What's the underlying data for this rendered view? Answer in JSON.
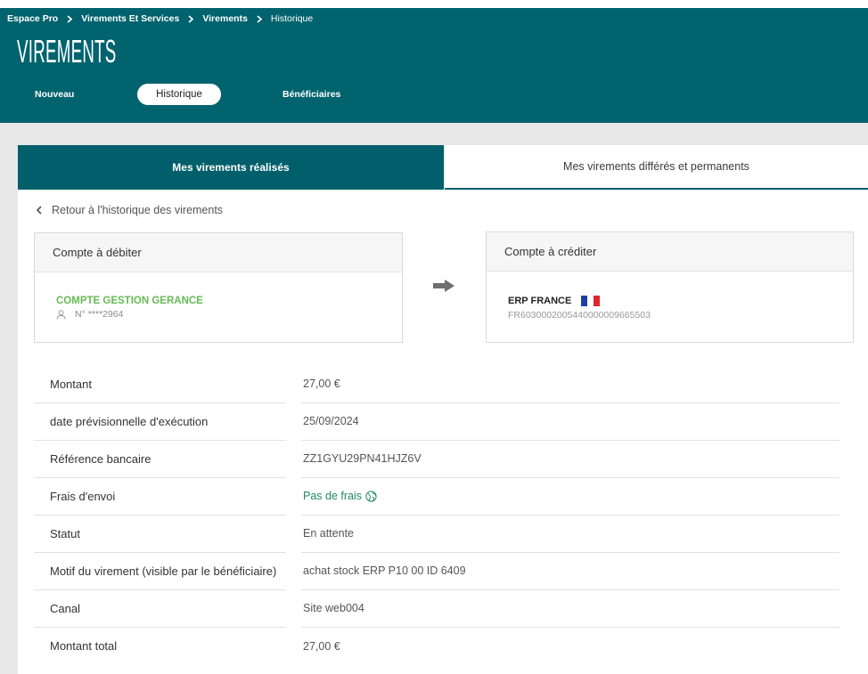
{
  "colors": {
    "header_bg": "#00636e",
    "tab_active_bg": "#005f6a",
    "page_bg": "#e8e8e8",
    "account_green": "#66bb55",
    "fee_green": "#1e8c5c"
  },
  "breadcrumb": {
    "items": [
      {
        "label": "Espace Pro"
      },
      {
        "label": "Virements Et Services"
      },
      {
        "label": "Virements"
      },
      {
        "label": "Historique"
      }
    ],
    "separator_icon": "chevron-right-icon"
  },
  "header": {
    "title": "VIREMENTS"
  },
  "nav": {
    "items": [
      {
        "label": "Nouveau",
        "active": false
      },
      {
        "label": "Historique",
        "active": true
      },
      {
        "label": "Bénéficiaires",
        "active": false
      }
    ]
  },
  "tabs": [
    {
      "label": "Mes virements réalisés",
      "active": true
    },
    {
      "label": "Mes virements différés et permanents",
      "active": false
    }
  ],
  "back_link": {
    "label": "Retour à l'historique des virements",
    "icon": "chevron-left-icon"
  },
  "debit_account": {
    "header": "Compte à débiter",
    "name": "COMPTE GESTION GERANCE",
    "number": "N° ****2964",
    "icon": "person-icon"
  },
  "transfer_icon": "arrow-right-icon",
  "credit_account": {
    "header": "Compte à créditer",
    "name": "ERP FRANCE",
    "iban": "FR6030002005440000009665503",
    "flag_icon": "french-flag-icon"
  },
  "details": [
    {
      "label": "Montant",
      "value": "27,00 €"
    },
    {
      "label": "date prévisionnelle d'exécution",
      "value": "25/09/2024"
    },
    {
      "label": "Référence bancaire",
      "value": "ZZ1GYU29PN41HJZ6V"
    },
    {
      "label": "Frais d'envoi",
      "value": "Pas de frais",
      "icon": "eco-globe-icon"
    },
    {
      "label": "Statut",
      "value": "En attente"
    },
    {
      "label": "Motif du virement (visible par le bénéficiaire)",
      "value": "achat stock ERP P10 00 ID 6409"
    },
    {
      "label": "Canal",
      "value": "Site web004"
    },
    {
      "label": "Montant total",
      "value": "27,00 €"
    }
  ]
}
